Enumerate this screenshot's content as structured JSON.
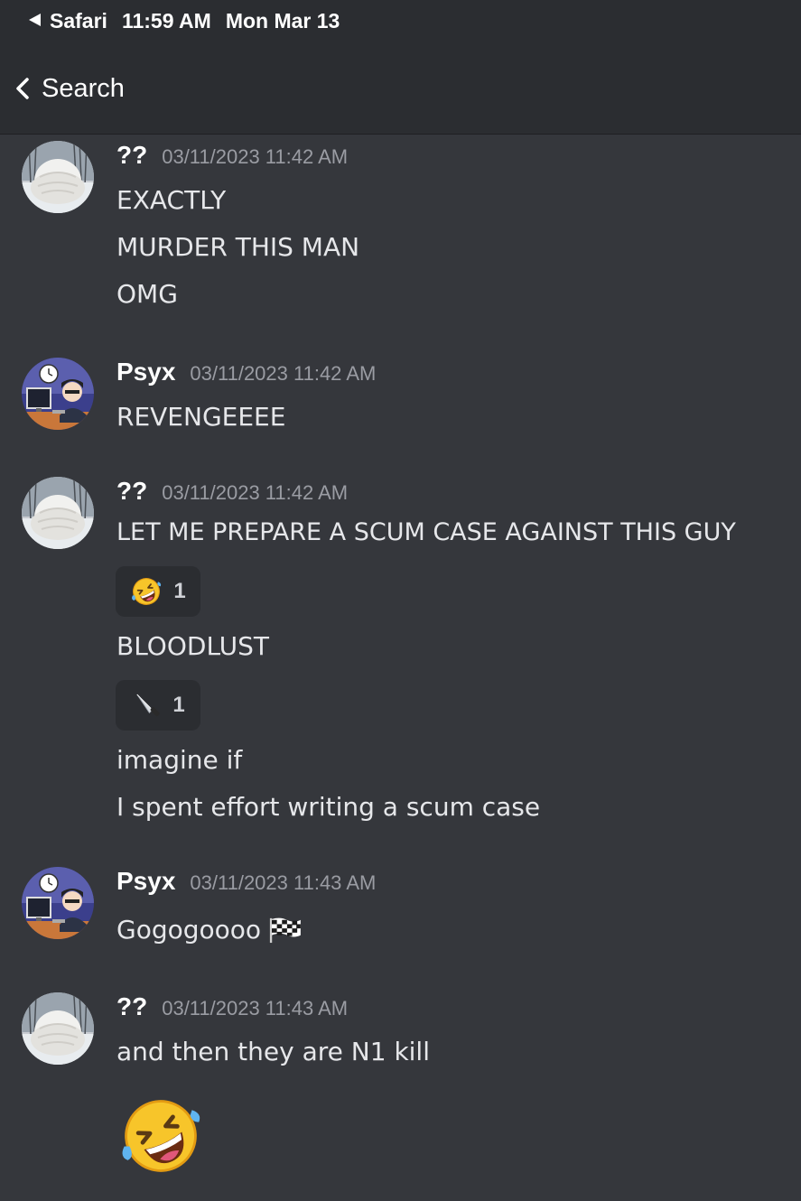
{
  "status_bar": {
    "back_app": "Safari",
    "time": "11:59 AM",
    "date": "Mon Mar 13"
  },
  "nav": {
    "back_label": "Search"
  },
  "messages": [
    {
      "author": "??",
      "timestamp": "03/11/2023 11:42 AM",
      "lines": [
        "EXACTLY",
        "MURDER THIS MAN",
        "OMG"
      ]
    },
    {
      "author": "Psyx",
      "timestamp": "03/11/2023 11:42 AM",
      "lines": [
        "REVENGEEEE"
      ]
    },
    {
      "author": "??",
      "timestamp": "03/11/2023 11:42 AM",
      "lines": [
        "LET ME PREPARE A SCUM CASE AGAINST THIS GUY",
        "BLOODLUST",
        "imagine if",
        "I spent effort writing a scum case"
      ],
      "reactions": [
        {
          "icon": "rolling-on-floor-laughing-icon",
          "count": "1"
        },
        {
          "icon": "knife-icon",
          "count": "1"
        }
      ]
    },
    {
      "author": "Psyx",
      "timestamp": "03/11/2023 11:43 AM",
      "lines": [
        "Gogogoooo"
      ],
      "trailing_icon": "chequered-flag-icon"
    },
    {
      "author": "??",
      "timestamp": "03/11/2023 11:43 AM",
      "lines": [
        "and then they are N1 kill"
      ],
      "big_emoji": "rolling-on-floor-laughing-icon"
    }
  ],
  "colors": {
    "background": "#35373c",
    "header": "#2b2d31",
    "timestamp": "#9a9ca3",
    "reaction_bg": "#2b2d31"
  }
}
